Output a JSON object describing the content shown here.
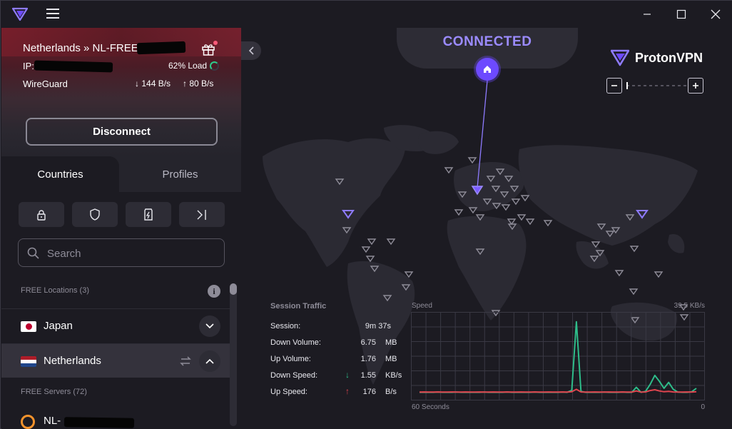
{
  "window": {
    "minimize_label": "minimize",
    "maximize_label": "maximize",
    "close_label": "close"
  },
  "connection": {
    "server_prefix": "Netherlands » NL-FREE#",
    "ip_prefix": "IP:",
    "load": "62% Load",
    "protocol": "WireGuard",
    "download_rate": "144 B/s",
    "upload_rate": "80 B/s",
    "disconnect_label": "Disconnect"
  },
  "tabs": [
    {
      "label": "Countries"
    },
    {
      "label": "Profiles"
    }
  ],
  "search": {
    "placeholder": "Search"
  },
  "free_locations_label": "FREE Locations (3)",
  "countries": [
    {
      "name": "Japan",
      "flag": "jp"
    },
    {
      "name": "Netherlands",
      "flag": "nl"
    }
  ],
  "free_servers_label": "FREE Servers (72)",
  "server_prefix": "NL-",
  "map": {
    "status": "CONNECTED",
    "brand": "ProtonVPN",
    "accent": "#6d4aff"
  },
  "session_traffic": {
    "title": "Session Traffic",
    "rows": [
      {
        "label": "Session:",
        "value": "9m 37s",
        "unit": ""
      },
      {
        "label": "Down Volume:",
        "value": "6.75",
        "unit": "MB"
      },
      {
        "label": "Up Volume:",
        "value": "1.76",
        "unit": "MB"
      },
      {
        "label": "Down Speed:",
        "value": "1.55",
        "unit": "KB/s"
      },
      {
        "label": "Up Speed:",
        "value": "176",
        "unit": "B/s"
      }
    ]
  },
  "speed_chart": {
    "title": "Speed",
    "max_label": "39.5  KB/s",
    "x_left_label": "60 Seconds",
    "x_right_label": "0",
    "download_color": "#2ebd8a",
    "upload_color": "#e0454f"
  },
  "chart_data": {
    "type": "line",
    "title": "Speed",
    "x": [
      60,
      59,
      58,
      57,
      56,
      55,
      54,
      53,
      52,
      51,
      50,
      49,
      48,
      47,
      46,
      45,
      44,
      43,
      42,
      41,
      40,
      39,
      38,
      37,
      36,
      35,
      34,
      33,
      32,
      31,
      30,
      29,
      28,
      27,
      26,
      25,
      24,
      23,
      22,
      21,
      20,
      19,
      18,
      17,
      16,
      15,
      14,
      13,
      12,
      11,
      10,
      9,
      8,
      7,
      6,
      5,
      4,
      3,
      2,
      1,
      0
    ],
    "xlabel": "60 Seconds",
    "ylabel": "KB/s",
    "ylim": [
      0,
      39.5
    ],
    "series": [
      {
        "name": "Down",
        "color": "#2ebd8a",
        "values": [
          0.5,
          0.5,
          0.5,
          0.5,
          0.6,
          0.5,
          0.5,
          0.5,
          0.6,
          0.5,
          0.5,
          0.5,
          0.5,
          0.5,
          0.6,
          0.5,
          0.5,
          0.5,
          0.5,
          0.6,
          0.5,
          0.5,
          0.5,
          0.5,
          0.5,
          0.6,
          0.5,
          0.5,
          0.5,
          0.5,
          0.5,
          0.6,
          0.5,
          1.5,
          36,
          1.0,
          0.5,
          0.5,
          0.5,
          0.5,
          0.6,
          0.5,
          0.5,
          0.5,
          0.6,
          0.5,
          0.5,
          3.0,
          0.5,
          1.0,
          4.5,
          9.0,
          6.0,
          2.5,
          5.5,
          2.0,
          0.6,
          0.5,
          0.5,
          0.8,
          2.5
        ]
      },
      {
        "name": "Up",
        "color": "#e0454f",
        "values": [
          0.6,
          0.7,
          0.6,
          0.6,
          0.7,
          0.6,
          0.6,
          0.7,
          0.6,
          0.6,
          0.7,
          0.6,
          0.6,
          0.7,
          0.6,
          0.6,
          0.7,
          0.6,
          0.6,
          0.7,
          0.6,
          0.6,
          0.7,
          0.6,
          0.6,
          0.7,
          0.6,
          0.6,
          0.7,
          0.6,
          0.6,
          0.7,
          0.6,
          0.8,
          2.0,
          0.7,
          0.6,
          0.6,
          0.7,
          0.6,
          0.6,
          0.7,
          0.6,
          0.6,
          0.7,
          0.6,
          0.6,
          1.2,
          0.6,
          0.7,
          1.4,
          1.8,
          1.2,
          0.8,
          1.0,
          0.7,
          0.6,
          0.6,
          0.7,
          0.6,
          0.8
        ]
      }
    ],
    "grid": true
  }
}
